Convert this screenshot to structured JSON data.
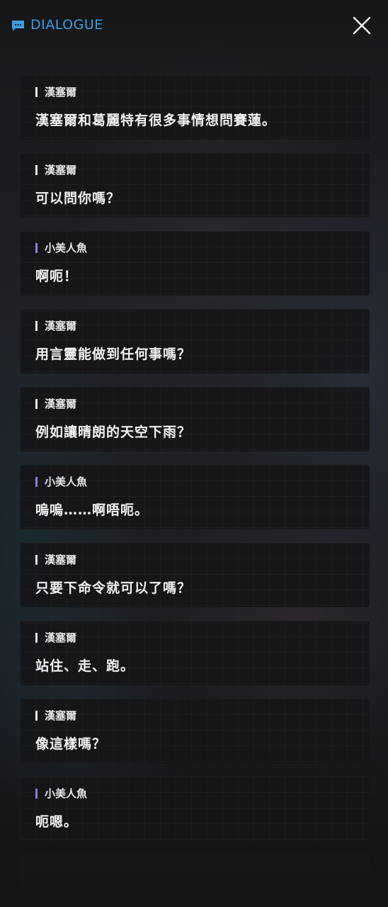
{
  "header": {
    "title": "DIALOGUE",
    "title_icon": "chat-bubble-icon",
    "close_icon": "close-icon",
    "accent_color": "#3d9de3"
  },
  "dialogue": [
    {
      "speaker": "漢塞爾",
      "text": "漢塞爾和葛麗特有很多事情想問賽蓮。"
    },
    {
      "speaker": "漢塞爾",
      "text": "可以問你嗎？"
    },
    {
      "speaker": "小美人魚",
      "text": "啊呃！"
    },
    {
      "speaker": "漢塞爾",
      "text": "用言靈能做到任何事嗎？"
    },
    {
      "speaker": "漢塞爾",
      "text": "例如讓晴朗的天空下雨？"
    },
    {
      "speaker": "小美人魚",
      "text": "嗚嗚……啊唔呃。"
    },
    {
      "speaker": "漢塞爾",
      "text": "只要下命令就可以了嗎？"
    },
    {
      "speaker": "漢塞爾",
      "text": "站住、走、跑。"
    },
    {
      "speaker": "漢塞爾",
      "text": "像這樣嗎？"
    },
    {
      "speaker": "小美人魚",
      "text": "呃嗯。"
    }
  ],
  "speaker_colors": {
    "漢塞爾": "#e8e8e8",
    "小美人魚": "#8f7fd9"
  }
}
